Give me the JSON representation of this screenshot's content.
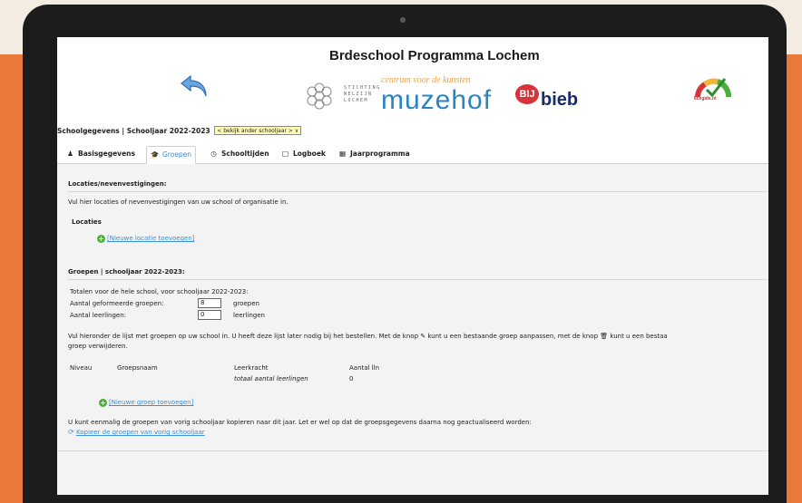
{
  "header": {
    "site_title": "Brdeschool Programma Lochem",
    "logo_stichting": "STICHTING\nWELZIJN\nLOCHEM",
    "logo_centrum": "centrum voor de kunsten",
    "logo_muzehof": "muzehof",
    "logo_bij": "BIJ",
    "logo_bieb": "bieb",
    "logo_gauge_label": "kcegids.nl"
  },
  "school_bar": {
    "label": "Schoolgegevens | Schooljaar 2022-2023",
    "select_value": "< bekijk ander schooljaar > ∨"
  },
  "tabs": [
    {
      "label": "Basisgegevens",
      "icon": "person-icon"
    },
    {
      "label": "Groepen",
      "icon": "graduation-cap-icon"
    },
    {
      "label": "Schooltijden",
      "icon": "clock-icon"
    },
    {
      "label": "Logboek",
      "icon": "book-icon"
    },
    {
      "label": "Jaarprogramma",
      "icon": "calendar-icon"
    }
  ],
  "locaties": {
    "heading": "Locaties/nevenvestigingen:",
    "intro": "Vul hier locaties of nevenvestigingen van uw school of organisatie in.",
    "subheading": "Locaties",
    "add_link": "[Nieuwe locatie toevoegen]"
  },
  "groepen": {
    "heading": "Groepen | schooljaar 2022-2023:",
    "totals_intro": "Totalen voor de hele school, voor schooljaar 2022-2023:",
    "groups_label": "Aantal geformeerde groepen:",
    "groups_value": "8",
    "groups_unit": "groepen",
    "students_label": "Aantal leerlingen:",
    "students_value": "0",
    "students_unit": "leerlingen",
    "info_line1": "Vul hieronder de lijst met groepen op uw school in. U heeft deze lijst later nodig bij het bestellen. Met de knop ✎ kunt u een bestaande groep aanpassen, met de knop 🗑 kunt u een bestaa",
    "info_line2": "groep verwijderen.",
    "table_headers": {
      "niveau": "Niveau",
      "groepsnaam": "Groepsnaam",
      "leerkracht": "Leerkracht",
      "aantal": "Aantal lln"
    },
    "total_label": "totaal aantal leerlingen",
    "total_value": "0",
    "add_link": "[Nieuwe groep toevoegen]",
    "copy_info": "U kunt eenmalig de groepen van vorig schooljaar kopieren naar dit jaar. Let er wel op dat de groepsgegevens daarna nog geactualiseerd worden:",
    "copy_link": "Kopieer de groepen van vorig schooljaar"
  },
  "colors": {
    "accent_blue": "#3a8fd6",
    "background_orange": "#e9793a",
    "add_green": "#4caf3a"
  }
}
